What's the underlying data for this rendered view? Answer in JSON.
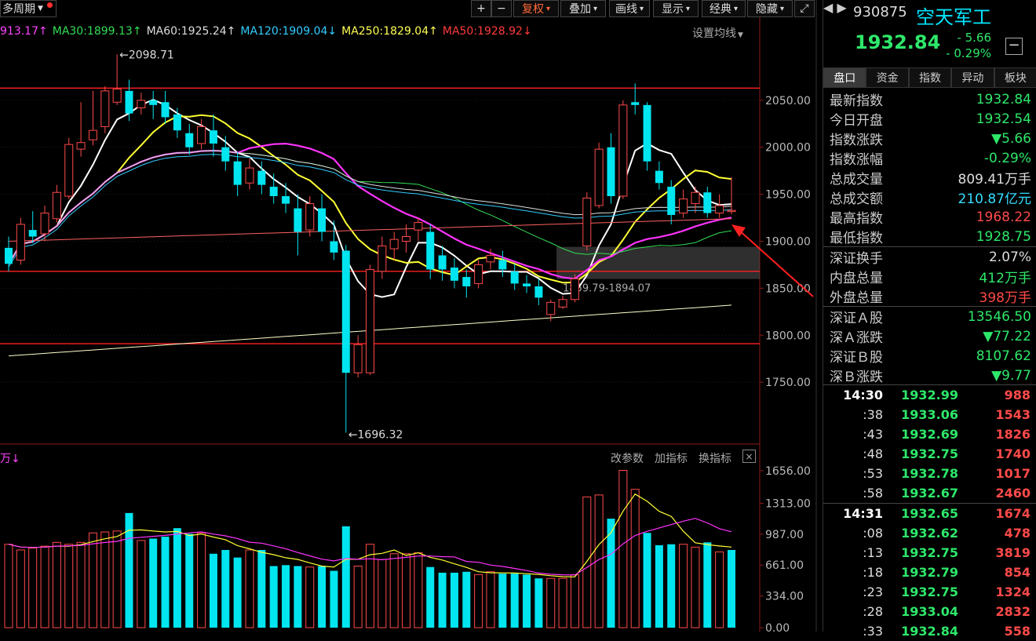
{
  "toolbar": {
    "period": "多周期",
    "buttons": [
      "+",
      "−",
      "复权",
      "叠加",
      "画线",
      "显示",
      "经典",
      "隐藏"
    ],
    "active_index": 2
  },
  "ma_legend": [
    {
      "label": "913.17",
      "arrow": "↑",
      "color": "#ff44ff"
    },
    {
      "label": "MA30:1899.13",
      "arrow": "↑",
      "color": "#33dd55"
    },
    {
      "label": "MA60:1925.24",
      "arrow": "↑",
      "color": "#dddddd"
    },
    {
      "label": "MA120:1909.04",
      "arrow": "↓",
      "color": "#33ccff"
    },
    {
      "label": "MA250:1829.04",
      "arrow": "↑",
      "color": "#ffff55"
    },
    {
      "label": "MA50:1928.92",
      "arrow": "↓",
      "color": "#ff3b3b"
    }
  ],
  "set_ma_label": "设置均线",
  "volume_panel": {
    "label": "万",
    "arrow": "↓",
    "tools": [
      "改参数",
      "加指标",
      "换指标"
    ],
    "close": "×"
  },
  "chart_data": {
    "type": "candlestick",
    "price_axis": {
      "ticks": [
        1750,
        1800,
        1850,
        1900,
        1950,
        2000,
        2050
      ],
      "labels": [
        "1750.00",
        "1800.00",
        "1850.00",
        "1900.00",
        "1950.00",
        "2000.00",
        "2050.00"
      ],
      "range": [
        1685,
        2115
      ]
    },
    "volume_axis": {
      "ticks": [
        0,
        334,
        661,
        987,
        1313,
        1656
      ],
      "labels": [
        "0.00",
        "334.00",
        "661.00",
        "987.00",
        "1313.00",
        "1656.00"
      ],
      "range": [
        0,
        1656
      ]
    },
    "annotations": {
      "high": "2098.71",
      "low": "1696.32",
      "zone": "1859.79-1894.07"
    },
    "horizontal_lines": [
      2063,
      1868,
      1791
    ],
    "zone": {
      "low": 1859.79,
      "high": 1894.07
    },
    "candles": [
      {
        "o": 1893,
        "h": 1905,
        "c": 1876,
        "l": 1868
      },
      {
        "o": 1880,
        "h": 1925,
        "c": 1918,
        "l": 1875
      },
      {
        "o": 1912,
        "h": 1932,
        "c": 1905,
        "l": 1898
      },
      {
        "o": 1908,
        "h": 1938,
        "c": 1930,
        "l": 1900
      },
      {
        "o": 1924,
        "h": 1960,
        "c": 1952,
        "l": 1920
      },
      {
        "o": 1948,
        "h": 2010,
        "c": 2003,
        "l": 1945
      },
      {
        "o": 1998,
        "h": 2048,
        "c": 2005,
        "l": 1990
      },
      {
        "o": 2008,
        "h": 2060,
        "c": 2018,
        "l": 2002
      },
      {
        "o": 2022,
        "h": 2065,
        "c": 2060,
        "l": 2015
      },
      {
        "o": 2048,
        "h": 2098.71,
        "c": 2062,
        "l": 2045
      },
      {
        "o": 2060,
        "h": 2072,
        "c": 2036,
        "l": 2028
      },
      {
        "o": 2042,
        "h": 2058,
        "c": 2050,
        "l": 2035
      },
      {
        "o": 2050,
        "h": 2060,
        "c": 2045,
        "l": 2030
      },
      {
        "o": 2048,
        "h": 2060,
        "c": 2032,
        "l": 2025
      },
      {
        "o": 2035,
        "h": 2042,
        "c": 2018,
        "l": 2010
      },
      {
        "o": 2015,
        "h": 2025,
        "c": 2000,
        "l": 1992
      },
      {
        "o": 2004,
        "h": 2030,
        "c": 2022,
        "l": 1998
      },
      {
        "o": 2018,
        "h": 2035,
        "c": 2004,
        "l": 1990
      },
      {
        "o": 2000,
        "h": 2012,
        "c": 1985,
        "l": 1975
      },
      {
        "o": 1985,
        "h": 1995,
        "c": 1960,
        "l": 1948
      },
      {
        "o": 1962,
        "h": 1988,
        "c": 1978,
        "l": 1955
      },
      {
        "o": 1975,
        "h": 1985,
        "c": 1960,
        "l": 1950
      },
      {
        "o": 1958,
        "h": 1972,
        "c": 1948,
        "l": 1940
      },
      {
        "o": 1948,
        "h": 1962,
        "c": 1940,
        "l": 1930
      },
      {
        "o": 1935,
        "h": 1950,
        "c": 1910,
        "l": 1885
      },
      {
        "o": 1912,
        "h": 1948,
        "c": 1940,
        "l": 1905
      },
      {
        "o": 1935,
        "h": 1950,
        "c": 1910,
        "l": 1900
      },
      {
        "o": 1900,
        "h": 1922,
        "c": 1888,
        "l": 1880
      },
      {
        "o": 1890,
        "h": 1896,
        "c": 1760,
        "l": 1696.32
      },
      {
        "o": 1760,
        "h": 1800,
        "c": 1790,
        "l": 1755
      },
      {
        "o": 1760,
        "h": 1875,
        "c": 1870,
        "l": 1758
      },
      {
        "o": 1868,
        "h": 1905,
        "c": 1895,
        "l": 1860
      },
      {
        "o": 1892,
        "h": 1910,
        "c": 1902,
        "l": 1880
      },
      {
        "o": 1900,
        "h": 1918,
        "c": 1905,
        "l": 1888
      },
      {
        "o": 1912,
        "h": 1925,
        "c": 1920,
        "l": 1900
      },
      {
        "o": 1910,
        "h": 1918,
        "c": 1870,
        "l": 1860
      },
      {
        "o": 1885,
        "h": 1895,
        "c": 1870,
        "l": 1858
      },
      {
        "o": 1872,
        "h": 1882,
        "c": 1858,
        "l": 1850
      },
      {
        "o": 1862,
        "h": 1870,
        "c": 1852,
        "l": 1840
      },
      {
        "o": 1855,
        "h": 1880,
        "c": 1875,
        "l": 1850
      },
      {
        "o": 1878,
        "h": 1892,
        "c": 1885,
        "l": 1870
      },
      {
        "o": 1880,
        "h": 1890,
        "c": 1870,
        "l": 1862
      },
      {
        "o": 1868,
        "h": 1876,
        "c": 1855,
        "l": 1848
      },
      {
        "o": 1855,
        "h": 1864,
        "c": 1852,
        "l": 1845
      },
      {
        "o": 1852,
        "h": 1860,
        "c": 1840,
        "l": 1832
      },
      {
        "o": 1822,
        "h": 1838,
        "c": 1835,
        "l": 1815
      },
      {
        "o": 1830,
        "h": 1842,
        "c": 1838,
        "l": 1828
      },
      {
        "o": 1838,
        "h": 1865,
        "c": 1860,
        "l": 1835
      },
      {
        "o": 1895,
        "h": 1952,
        "c": 1946,
        "l": 1890
      },
      {
        "o": 1938,
        "h": 2005,
        "c": 1998,
        "l": 1935
      },
      {
        "o": 2000,
        "h": 2015,
        "c": 1948,
        "l": 1940
      },
      {
        "o": 1948,
        "h": 2050,
        "c": 2045,
        "l": 1945
      },
      {
        "o": 2048,
        "h": 2068,
        "c": 2045,
        "l": 2035
      },
      {
        "o": 2045,
        "h": 2048,
        "c": 1985,
        "l": 1975
      },
      {
        "o": 1975,
        "h": 1985,
        "c": 1962,
        "l": 1955
      },
      {
        "o": 1958,
        "h": 1965,
        "c": 1928,
        "l": 1918
      },
      {
        "o": 1930,
        "h": 1955,
        "c": 1945,
        "l": 1925
      },
      {
        "o": 1940,
        "h": 1958,
        "c": 1952,
        "l": 1930
      },
      {
        "o": 1952,
        "h": 1958,
        "c": 1930,
        "l": 1925
      },
      {
        "o": 1930,
        "h": 1950,
        "c": 1938,
        "l": 1925
      },
      {
        "o": 1932.54,
        "h": 1968.22,
        "c": 1932.84,
        "l": 1928.75
      }
    ],
    "volumes": [
      880,
      820,
      840,
      860,
      900,
      880,
      900,
      1000,
      1010,
      1020,
      1210,
      920,
      940,
      960,
      1050,
      990,
      1000,
      780,
      820,
      740,
      820,
      820,
      650,
      660,
      650,
      640,
      650,
      600,
      1070,
      650,
      880,
      720,
      780,
      780,
      790,
      640,
      580,
      580,
      590,
      560,
      590,
      570,
      570,
      560,
      520,
      520,
      520,
      560,
      1380,
      1400,
      1150,
      1660,
      1460,
      1000,
      870,
      880,
      880,
      850,
      900,
      800,
      820
    ],
    "vol_up": [
      true,
      true,
      true,
      true,
      true,
      true,
      true,
      true,
      true,
      true,
      false,
      true,
      false,
      false,
      false,
      false,
      true,
      false,
      false,
      false,
      true,
      false,
      false,
      false,
      false,
      true,
      false,
      false,
      false,
      true,
      true,
      true,
      true,
      true,
      true,
      false,
      false,
      false,
      false,
      true,
      true,
      false,
      false,
      false,
      false,
      true,
      true,
      true,
      true,
      true,
      false,
      true,
      true,
      false,
      false,
      false,
      true,
      true,
      false,
      true,
      false
    ]
  },
  "quote": {
    "code": "930875",
    "name": "空天军工",
    "last": "1932.84",
    "change": "- 5.66",
    "change_pct": "- 0.29%",
    "minus": "−",
    "tabs": [
      "盘口",
      "资金",
      "指数",
      "异动",
      "板块"
    ],
    "info": [
      {
        "k": "最新指数",
        "v": "1932.84",
        "c": "#2ee86a"
      },
      {
        "k": "今日开盘",
        "v": "1932.54",
        "c": "#2ee86a"
      },
      {
        "k": "指数涨跌",
        "v": "▼5.66",
        "c": "#2ee86a"
      },
      {
        "k": "指数涨幅",
        "v": "-0.29%",
        "c": "#2ee86a"
      },
      {
        "k": "总成交量",
        "v": "809.41万手",
        "c": "#dddddd"
      },
      {
        "k": "总成交额",
        "v": "210.87亿元",
        "c": "#33ddff"
      },
      {
        "k": "最高指数",
        "v": "1968.22",
        "c": "#ff4a4a"
      },
      {
        "k": "最低指数",
        "v": "1928.75",
        "c": "#2ee86a"
      },
      {
        "k": "深证换手",
        "v": "2.07%",
        "c": "#dddddd",
        "sep": true
      },
      {
        "k": "内盘总量",
        "v": "412万手",
        "c": "#2ee86a"
      },
      {
        "k": "外盘总量",
        "v": "398万手",
        "c": "#ff4a4a"
      },
      {
        "k": "深证Ａ股",
        "v": "13546.50",
        "c": "#2ee86a",
        "sep": true
      },
      {
        "k": "深Ａ涨跌",
        "v": "▼77.22",
        "c": "#2ee86a"
      },
      {
        "k": "深证Ｂ股",
        "v": "8107.62",
        "c": "#2ee86a"
      },
      {
        "k": "深Ｂ涨跌",
        "v": "▼9.77",
        "c": "#2ee86a"
      }
    ],
    "ticks": [
      {
        "t": "14:30",
        "p": "1932.99",
        "v": "988",
        "first": true
      },
      {
        "t": ":38",
        "p": "1933.06",
        "v": "1543"
      },
      {
        "t": ":43",
        "p": "1932.69",
        "v": "1826"
      },
      {
        "t": ":48",
        "p": "1932.75",
        "v": "1740"
      },
      {
        "t": ":53",
        "p": "1932.78",
        "v": "1017"
      },
      {
        "t": ":58",
        "p": "1932.67",
        "v": "2460"
      },
      {
        "t": "14:31",
        "p": "1932.65",
        "v": "1674",
        "first": true,
        "sep": true
      },
      {
        "t": ":08",
        "p": "1932.62",
        "v": "478"
      },
      {
        "t": ":13",
        "p": "1932.75",
        "v": "3819"
      },
      {
        "t": ":18",
        "p": "1932.79",
        "v": "854"
      },
      {
        "t": ":23",
        "p": "1932.75",
        "v": "1324"
      },
      {
        "t": ":28",
        "p": "1933.04",
        "v": "2832"
      },
      {
        "t": ":33",
        "p": "1932.84",
        "v": "558"
      }
    ]
  }
}
